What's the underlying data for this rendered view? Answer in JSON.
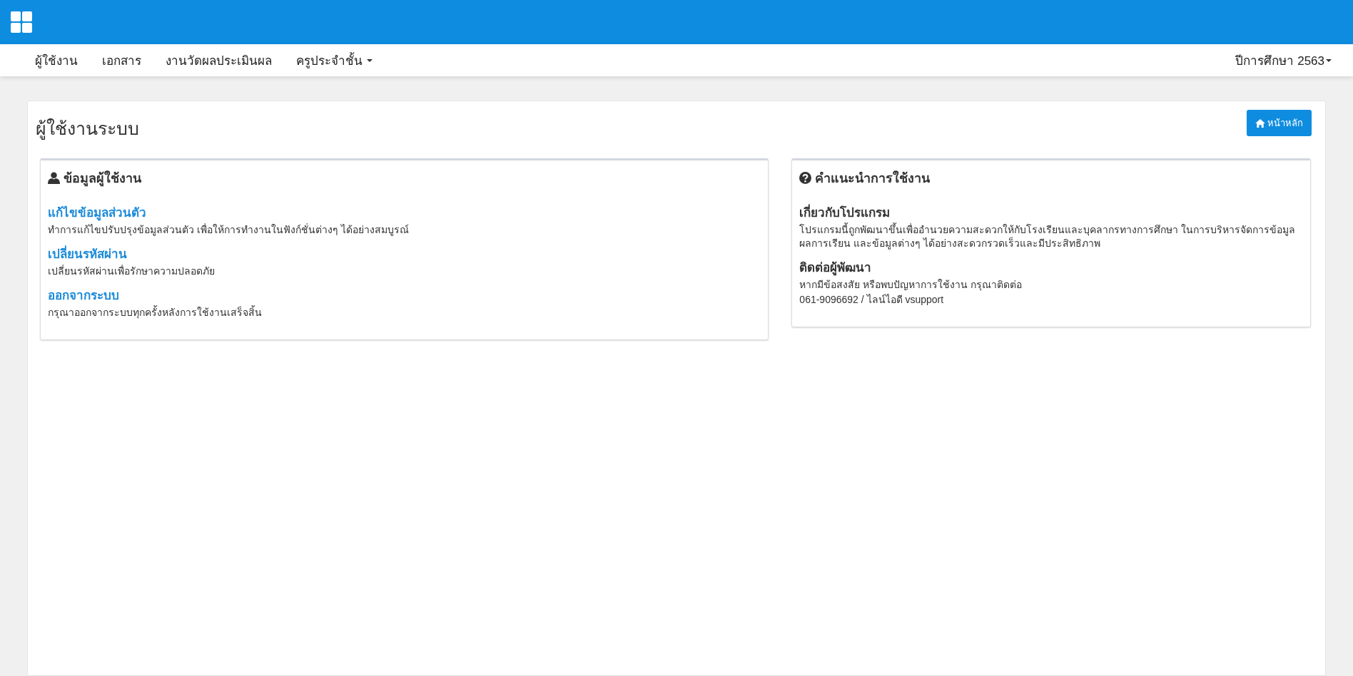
{
  "nav": {
    "items": [
      {
        "label": "ผู้ใช้งาน",
        "dropdown": false
      },
      {
        "label": "เอกสาร",
        "dropdown": false
      },
      {
        "label": "งานวัดผลประเมินผล",
        "dropdown": false
      },
      {
        "label": "ครูประจำชั้น",
        "dropdown": true
      }
    ],
    "year": {
      "label": "ปีการศึกษา 2563",
      "dropdown": true
    }
  },
  "page": {
    "title": "ผู้ใช้งานระบบ",
    "home_button": "หน้าหลัก"
  },
  "user_panel": {
    "heading": "ข้อมูลผู้ใช้งาน",
    "links": [
      {
        "title": "แก้ไขข้อมูลส่วนตัว",
        "description": "ทำการแก้ไขปรับปรุงข้อมูลส่วนตัว เพื่อให้การทำงานในฟังก์ชั่นต่างๆ ได้อย่างสมบูรณ์"
      },
      {
        "title": "เปลี่ยนรหัสผ่าน",
        "description": "เปลี่ยนรหัสผ่านเพื่อรักษาความปลอดภัย"
      },
      {
        "title": "ออกจากระบบ",
        "description": "กรุณาออกจากระบบทุกครั้งหลังการใช้งานเสร็จสิ้น"
      }
    ]
  },
  "help_panel": {
    "heading": "คำแนะนำการใช้งาน",
    "sections": [
      {
        "title": "เกี่ยวกับโปรแกรม",
        "lines": [
          "โปรแกรมนี้ถูกพัฒนาขึ้นเพื่ออำนวยความสะดวกให้กับโรงเรียนและบุคลากรทางการศึกษา ในการบริหารจัดการข้อมูลผลการเรียน และข้อมูลต่างๆ ได้อย่างสะดวกรวดเร็วและมีประสิทธิภาพ"
        ]
      },
      {
        "title": "ติดต่อผู้พัฒนา",
        "lines": [
          "หากมีข้อสงสัย หรือพบปัญหาการใช้งาน กรุณาติดต่อ",
          "061-9096692 / ไลน์ไอดี vsupport"
        ]
      }
    ]
  }
}
